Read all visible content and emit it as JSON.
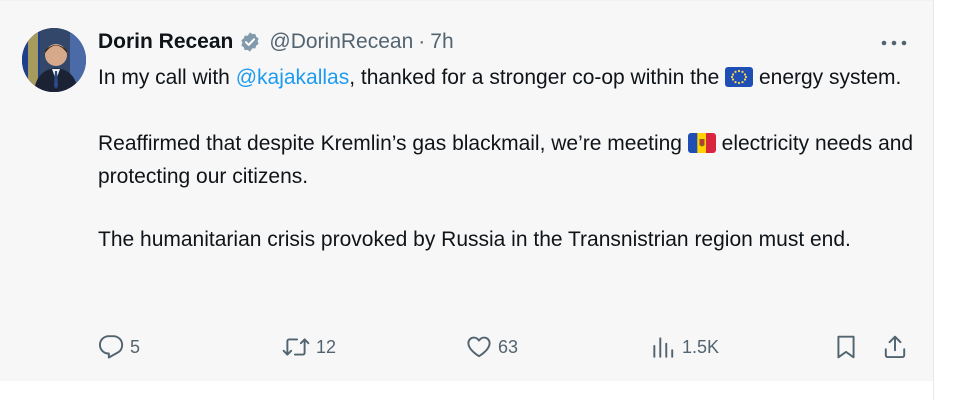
{
  "author": {
    "name": "Dorin Recean",
    "handle": "@DorinRecean",
    "separator": "·",
    "time": "7h"
  },
  "tweet": {
    "p1_pre": "In my call with ",
    "p1_mention": "@kajakallas",
    "p1_mid": ", thanked for a stronger co-op within the ",
    "p1_post": " energy system.",
    "p2_pre": "Reaffirmed that despite Kremlin’s gas blackmail, we’re meeting ",
    "p2_post": " electricity needs and protecting our citizens.",
    "p3": "The humanitarian crisis provoked by Russia in the Transnistrian region must end."
  },
  "actions": {
    "replies": "5",
    "reposts": "12",
    "likes": "63",
    "views": "1.5K"
  },
  "icons": {
    "verified": "verified-badge-icon",
    "more": "more-options-icon",
    "reply": "reply-icon",
    "repost": "repost-icon",
    "like": "heart-icon",
    "views": "views-chart-icon",
    "bookmark": "bookmark-icon",
    "share": "share-icon",
    "eu_flag": "eu-flag-icon",
    "md_flag": "moldova-flag-icon"
  },
  "colors": {
    "mention": "#1d9bf0",
    "muted": "#536471",
    "text": "#0f1419",
    "background": "#f7f7f7"
  }
}
